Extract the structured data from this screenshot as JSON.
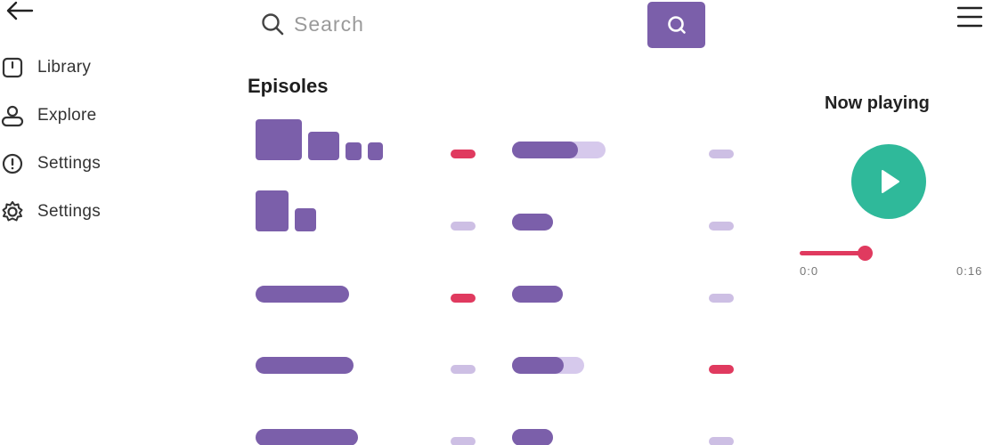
{
  "nav": {
    "items": [
      {
        "label": "Library",
        "icon": "library-icon"
      },
      {
        "label": "Explore",
        "icon": "profile-icon"
      },
      {
        "label": "Settings",
        "icon": "info-icon"
      },
      {
        "label": "Settings",
        "icon": "gear-icon"
      }
    ]
  },
  "search": {
    "placeholder": "Search"
  },
  "episodes": {
    "title": "Episoles",
    "rows": [
      {
        "progress": 0.7
      },
      {
        "progress": 1.0
      },
      {
        "progress": 1.0
      },
      {
        "progress": 0.72
      },
      {
        "progress": 1.0
      }
    ]
  },
  "player": {
    "title": "Now playing",
    "elapsed": "0:0",
    "duration": "0:16",
    "position": 0.8
  },
  "colors": {
    "accent": "#7b5faa",
    "accent_light": "#cdbfe4",
    "alert": "#e03a5f",
    "play": "#2fb99a"
  }
}
